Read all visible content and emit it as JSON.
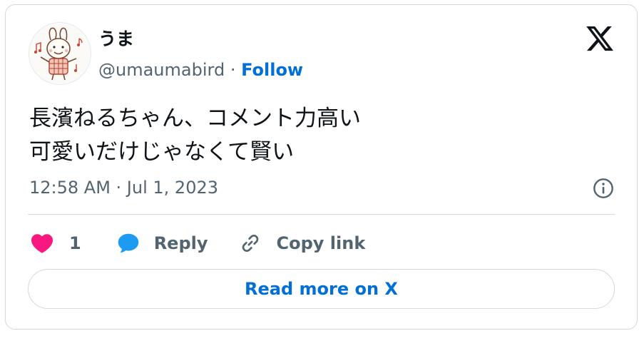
{
  "author": {
    "display_name": "うま",
    "handle": "@umaumabird",
    "separator": " · ",
    "follow_label": "Follow"
  },
  "tweet": {
    "lines": [
      "長濱ねるちゃん、コメント力高い",
      "可愛いだけじゃなくて賢い"
    ],
    "timestamp": "12:58 AM · Jul 1, 2023"
  },
  "actions": {
    "like_count": "1",
    "reply_label": "Reply",
    "copy_link_label": "Copy link"
  },
  "footer": {
    "read_more_label": "Read more on X"
  },
  "icons": {
    "like": "heart-icon",
    "reply": "speech-bubble-icon",
    "copy_link": "link-icon",
    "info": "info-icon",
    "brand": "x-logo-icon"
  },
  "colors": {
    "like": "#f91880",
    "reply": "#1d9bf0",
    "link": "#006fd6",
    "muted": "#536471",
    "border": "#cfd9de"
  }
}
